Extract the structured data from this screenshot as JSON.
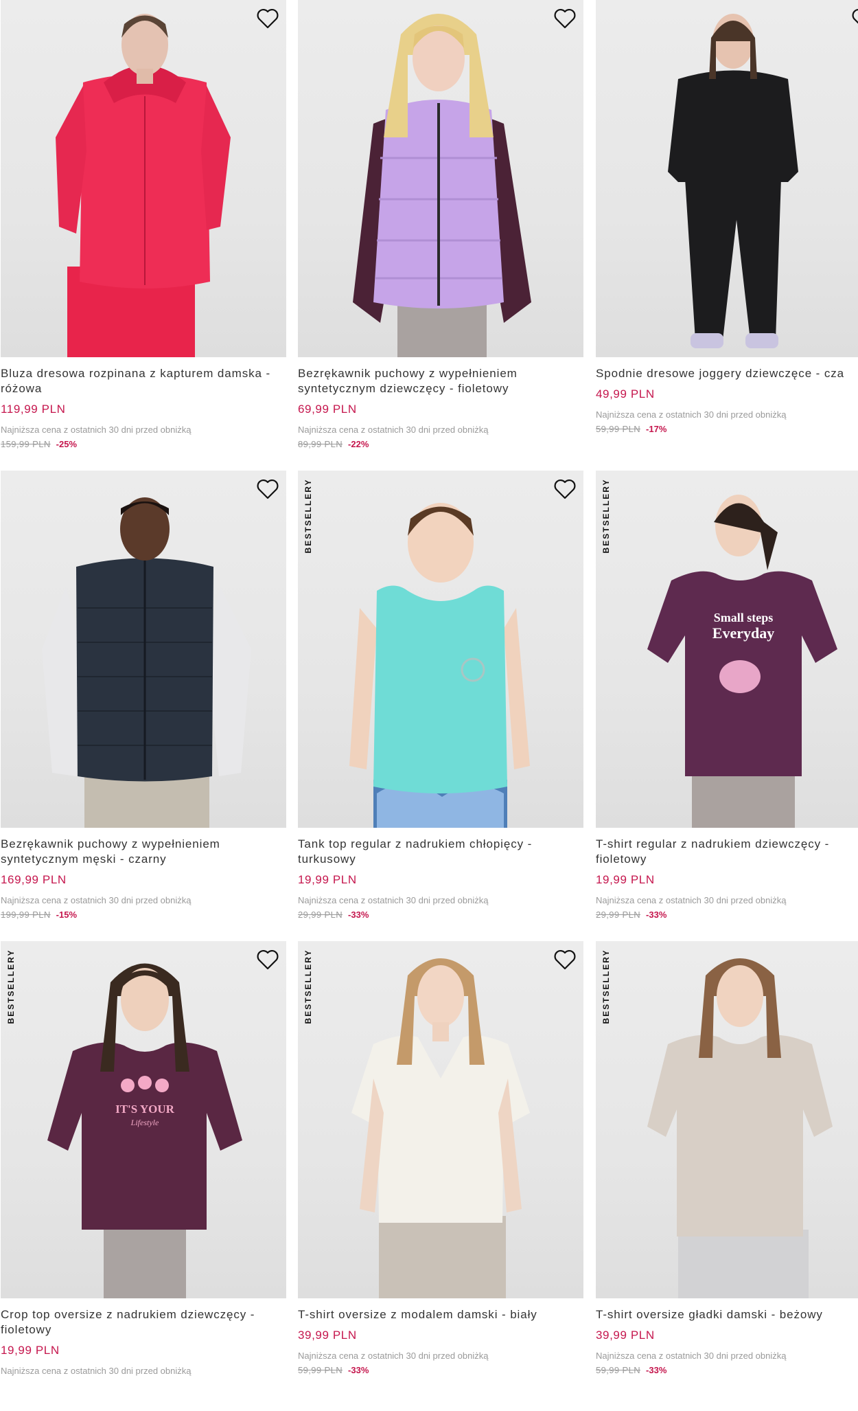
{
  "badge_label": "BESTSELLERY",
  "lowest_price_note": "Najniższa cena z ostatnich 30 dni przed obniżką",
  "colors": {
    "price": "#c5164d",
    "discount": "#c5164d",
    "muted": "#9a9a9a",
    "text": "#333333"
  },
  "products": [
    {
      "name": "Bluza dresowa rozpinana z kapturem damska - różowa",
      "price": "119,99 PLN",
      "old_price": "159,99 PLN",
      "discount": "-25%",
      "bestseller": false,
      "favorite_icon": "heart-outline-icon",
      "garment_color": "#ee2d55"
    },
    {
      "name": "Bezrękawnik puchowy z wypełnieniem syntetycznym dziewczęcy - fioletowy",
      "price": "69,99 PLN",
      "old_price": "89,99 PLN",
      "discount": "-22%",
      "bestseller": false,
      "favorite_icon": "heart-outline-icon",
      "garment_color": "#c6a4e8"
    },
    {
      "name": "Spodnie dresowe joggery dziewczęce - cza",
      "price": "49,99 PLN",
      "old_price": "59,99 PLN",
      "discount": "-17%",
      "bestseller": false,
      "favorite_icon": "heart-outline-icon",
      "garment_color": "#1c1c1e"
    },
    {
      "name": "Bezrękawnik puchowy z wypełnieniem syntetycznym męski - czarny",
      "price": "169,99 PLN",
      "old_price": "199,99 PLN",
      "discount": "-15%",
      "bestseller": false,
      "favorite_icon": "heart-outline-icon",
      "garment_color": "#2a3340"
    },
    {
      "name": "Tank top regular z nadrukiem chłopięcy - turkusowy",
      "price": "19,99 PLN",
      "old_price": "29,99 PLN",
      "discount": "-33%",
      "bestseller": true,
      "favorite_icon": "heart-outline-icon",
      "garment_color": "#6fdcd6"
    },
    {
      "name": "T-shirt regular z nadrukiem dziewczęcy - fioletowy",
      "price": "19,99 PLN",
      "old_price": "29,99 PLN",
      "discount": "-33%",
      "bestseller": true,
      "favorite_icon": "heart-outline-icon",
      "garment_color": "#5e2a4f",
      "print_text": [
        "Small steps",
        "Everyday"
      ]
    },
    {
      "name": "Crop top oversize z nadrukiem dziewczęcy - fioletowy",
      "price": "19,99 PLN",
      "old_price": "",
      "discount": "",
      "bestseller": true,
      "favorite_icon": "heart-outline-icon",
      "garment_color": "#5a2743",
      "print_text": [
        "IT'S YOUR",
        "Lifestyle"
      ]
    },
    {
      "name": "T-shirt oversize z modalem damski - biały",
      "price": "39,99 PLN",
      "old_price": "59,99 PLN",
      "discount": "-33%",
      "bestseller": true,
      "favorite_icon": "heart-outline-icon",
      "garment_color": "#f3f1ea"
    },
    {
      "name": "T-shirt oversize gładki damski - beżowy",
      "price": "39,99 PLN",
      "old_price": "59,99 PLN",
      "discount": "-33%",
      "bestseller": true,
      "favorite_icon": "heart-outline-icon",
      "garment_color": "#d8cfc6"
    }
  ]
}
